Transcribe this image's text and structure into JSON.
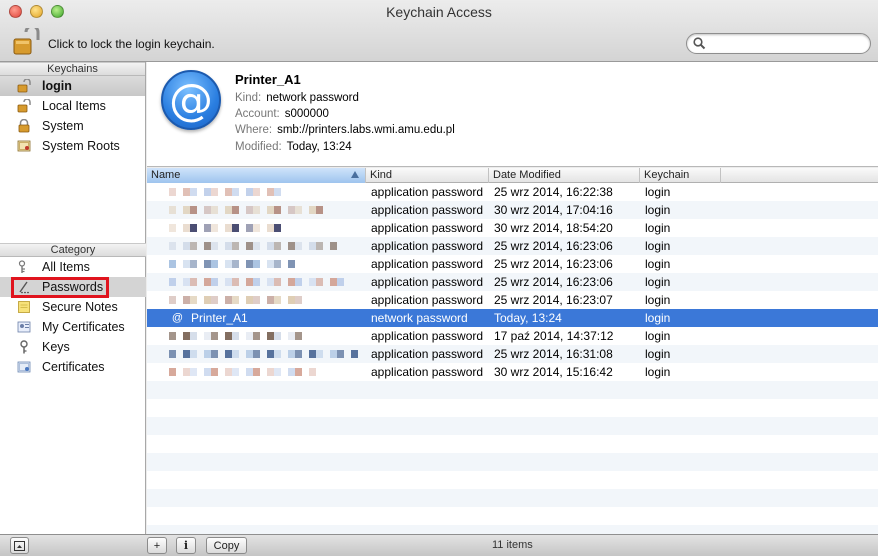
{
  "window": {
    "title": "Keychain Access"
  },
  "toolbar": {
    "lock_text": "Click to lock the login keychain.",
    "search_placeholder": ""
  },
  "sidebar": {
    "keychains_header": "Keychains",
    "keychains": [
      {
        "label": "login",
        "icon": "lock-open-icon",
        "selected": true
      },
      {
        "label": "Local Items",
        "icon": "lock-open-icon",
        "selected": false
      },
      {
        "label": "System",
        "icon": "lock-closed-icon",
        "selected": false
      },
      {
        "label": "System Roots",
        "icon": "certificate-icon",
        "selected": false
      }
    ],
    "category_header": "Category",
    "categories": [
      {
        "label": "All Items",
        "icon": "people-key-icon"
      },
      {
        "label": "Passwords",
        "icon": "password-pen-icon",
        "selected": true
      },
      {
        "label": "Secure Notes",
        "icon": "note-icon"
      },
      {
        "label": "My Certificates",
        "icon": "my-certificate-icon"
      },
      {
        "label": "Keys",
        "icon": "key-icon"
      },
      {
        "label": "Certificates",
        "icon": "certificate-icon"
      }
    ]
  },
  "detail": {
    "name": "Printer_A1",
    "kind_label": "Kind:",
    "kind": "network password",
    "account_label": "Account:",
    "account": "s000000",
    "where_label": "Where:",
    "where": "smb://printers.labs.wmi.amu.edu.pl",
    "modified_label": "Modified:",
    "modified": "Today, 13:24"
  },
  "table": {
    "columns": [
      "Name",
      "Kind",
      "Date Modified",
      "Keychain"
    ],
    "rows": [
      {
        "name": "",
        "kind": "application password",
        "date": "25 wrz 2014, 16:22:38",
        "keychain": "login"
      },
      {
        "name": "",
        "kind": "application password",
        "date": "30 wrz 2014, 17:04:16",
        "keychain": "login"
      },
      {
        "name": "",
        "kind": "application password",
        "date": "30 wrz 2014, 18:54:20",
        "keychain": "login"
      },
      {
        "name": "",
        "kind": "application password",
        "date": "25 wrz 2014, 16:23:06",
        "keychain": "login"
      },
      {
        "name": "",
        "kind": "application password",
        "date": "25 wrz 2014, 16:23:06",
        "keychain": "login"
      },
      {
        "name": "",
        "kind": "application password",
        "date": "25 wrz 2014, 16:23:06",
        "keychain": "login"
      },
      {
        "name": "",
        "kind": "application password",
        "date": "25 wrz 2014, 16:23:07",
        "keychain": "login"
      },
      {
        "name": "Printer_A1",
        "kind": "network password",
        "date": "Today, 13:24",
        "keychain": "login",
        "selected": true
      },
      {
        "name": "",
        "kind": "application password",
        "date": "17 paź 2014, 14:37:12",
        "keychain": "login"
      },
      {
        "name": "",
        "kind": "application password",
        "date": "25 wrz 2014, 16:31:08",
        "keychain": "login"
      },
      {
        "name": "",
        "kind": "application password",
        "date": "30 wrz 2014, 15:16:42",
        "keychain": "login"
      }
    ]
  },
  "bottombar": {
    "add_label": "+",
    "info_label": "i",
    "copy_label": "Copy",
    "count": "11 items"
  },
  "colors": {
    "selection": "#3b78d8",
    "highlight_box": "#e0141e",
    "accent_icon": "#2a7ee0"
  }
}
